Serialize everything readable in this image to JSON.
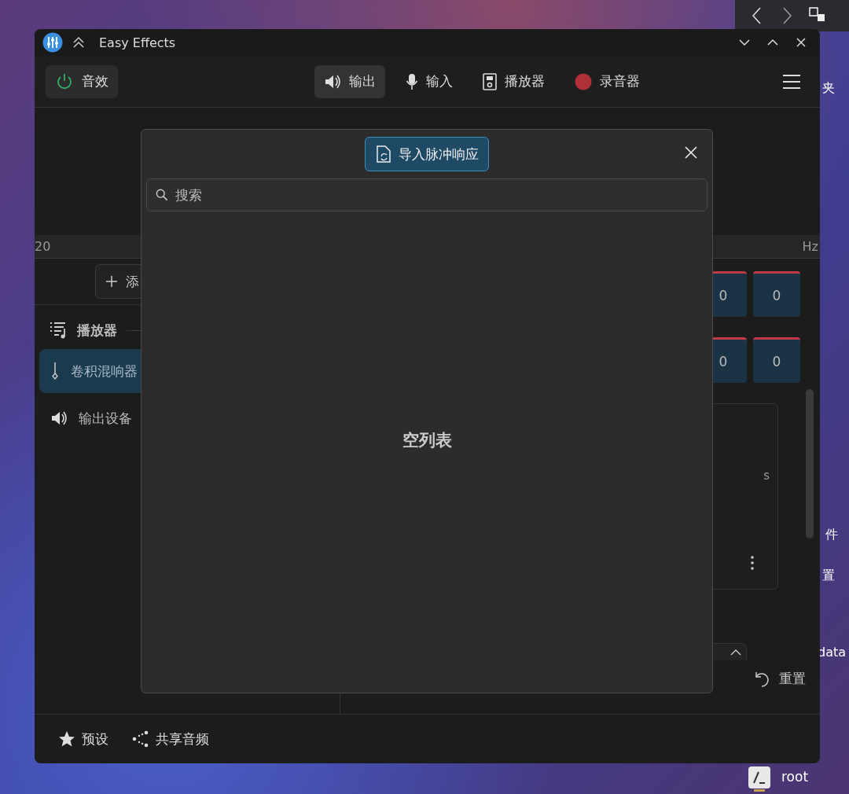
{
  "window": {
    "title": "Easy Effects"
  },
  "toolbar": {
    "effects_toggle": {
      "label": "音效",
      "on": true
    },
    "tabs": [
      {
        "label": "输出",
        "selected": true,
        "kind": "speaker"
      },
      {
        "label": "输入",
        "selected": false,
        "kind": "mic"
      },
      {
        "label": "播放器",
        "selected": false,
        "kind": "player"
      },
      {
        "label": "录音器",
        "selected": false,
        "kind": "record"
      }
    ]
  },
  "spectrum_axis": {
    "start": "20",
    "unit": "Hz"
  },
  "sidebar": {
    "add_button": "添",
    "section": "播放器",
    "items": [
      {
        "label": "卷积混响器",
        "selected": true,
        "kind": "plugin"
      },
      {
        "label": "输出设备",
        "selected": false,
        "kind": "device"
      }
    ]
  },
  "level_rows": [
    {
      "values": [
        "0",
        "0"
      ]
    },
    {
      "values": [
        "0",
        "0"
      ]
    }
  ],
  "card": {
    "unit": "s"
  },
  "reset_button": "重置",
  "footer": [
    {
      "label": "预设",
      "kind": "star"
    },
    {
      "label": "共享音频",
      "kind": "share"
    }
  ],
  "dialog": {
    "import_button": "导入脉冲响应",
    "search": {
      "placeholder": "搜索"
    },
    "empty_text": "空列表"
  },
  "desktop": {
    "labels": [
      "夹",
      "件",
      "置",
      "data"
    ],
    "user": "root"
  }
}
